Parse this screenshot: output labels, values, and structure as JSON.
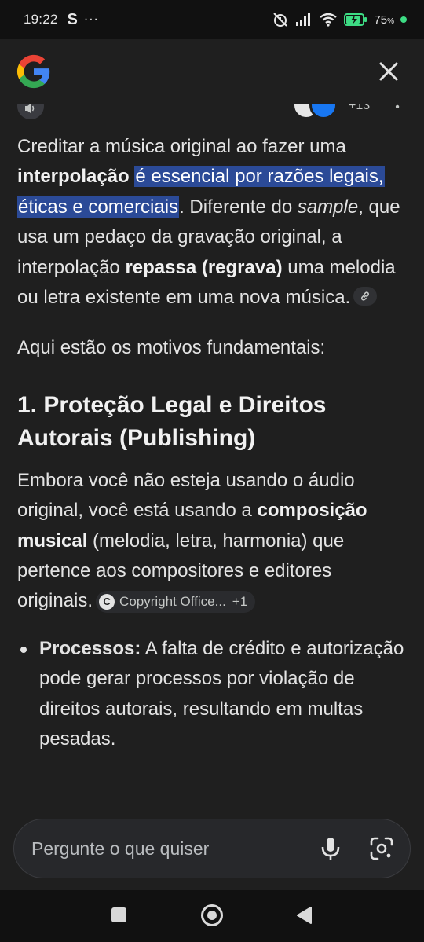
{
  "status_bar": {
    "time": "19:22",
    "app_letter": "S",
    "dots": "···",
    "battery_pct": "75",
    "battery_unit": "%"
  },
  "header": {
    "logo_icon": "google-g-icon",
    "close_icon": "close-icon"
  },
  "sources": {
    "extra_count": "+13"
  },
  "answer": {
    "p1_a": "Creditar a música original ao fazer uma ",
    "p1_b": "interpolação",
    "p1_c": " ",
    "p1_hl": "é essencial por razões legais, éticas e comerciais",
    "p1_d": ". Diferente do ",
    "p1_e": "sample",
    "p1_f": ", que usa um pedaço da gravação original, a interpolação ",
    "p1_g": "repassa (regrava)",
    "p1_h": " uma melodia ou letra existente em uma nova música.",
    "p2": "Aqui estão os motivos fundamentais:",
    "heading1": "1. Proteção Legal e Direitos Autorais (Publishing)",
    "p3_a": "Embora você não esteja usando o áudio original, você está usando a ",
    "p3_b": "composição musical",
    "p3_c": " (melodia, letra, harmonia) que pertence aos compositores e editores originais.",
    "source_chip": {
      "icon_letter": "C",
      "label": "Copyright Office...",
      "plus": "+1"
    },
    "bullets": [
      {
        "term": "Processos:",
        "text": " A falta de crédito e autorização pode gerar processos por violação de direitos autorais, resultando em multas pesadas."
      }
    ]
  },
  "input": {
    "placeholder": "Pergunte o que quiser"
  },
  "colors": {
    "background": "#1f1f1f",
    "highlight": "#2b4a97",
    "text": "#e3e3e3"
  }
}
